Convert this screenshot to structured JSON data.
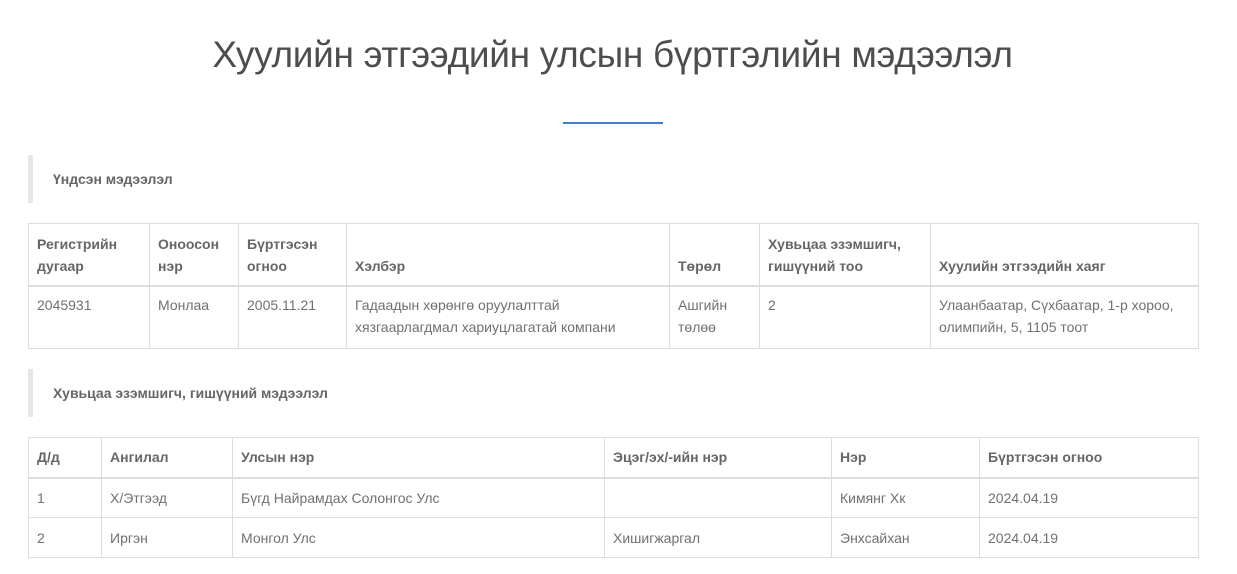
{
  "page": {
    "title": "Хуулийн этгээдийн улсын бүртгэлийн мэдээлэл"
  },
  "basic_section": {
    "title": "Үндсэн мэдээлэл",
    "headers": [
      "Регистрийн дугаар",
      "Оноосон нэр",
      "Бүртгэсэн огноо",
      "Хэлбэр",
      "Төрөл",
      "Хувьцаа эзэмшигч, гишүүний тоо",
      "Хуулийн этгээдийн хаяг"
    ],
    "rows": [
      [
        "2045931",
        "Монлаа",
        "2005.11.21",
        "Гадаадын хөрөнгө оруулалттай хязгаарлагдмал хариуцлагатай компани",
        "Ашгийн төлөө",
        "2",
        "Улаанбаатар, Сүхбаатар, 1-р хороо, олимпийн, 5, 1105 тоот"
      ]
    ]
  },
  "members_section": {
    "title": "Хувьцаа эзэмшигч, гишүүний мэдээлэл",
    "headers": [
      "Д/д",
      "Ангилал",
      "Улсын нэр",
      "Эцэг/эх/-ийн нэр",
      "Нэр",
      "Бүртгэсэн огноо"
    ],
    "rows": [
      [
        "1",
        "Х/Этгээд",
        "Бүгд Найрамдах Солонгос Улс",
        "",
        "Кимянг Хк",
        "2024.04.19"
      ],
      [
        "2",
        "Иргэн",
        "Монгол Улс",
        "Хишигжаргал",
        "Энхсайхан",
        "2024.04.19"
      ]
    ]
  },
  "colors": {
    "accent": "#3f7dd1",
    "border": "#dddddd",
    "section_bar": "#e6e6e6"
  }
}
